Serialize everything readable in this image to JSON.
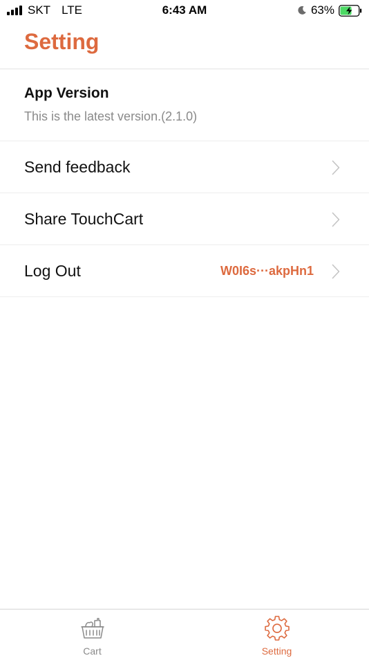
{
  "status_bar": {
    "carrier": "SKT",
    "network": "LTE",
    "time": "6:43 AM",
    "battery_percent": "63%",
    "battery_level": 0.63,
    "icons": [
      "signal-icon",
      "moon-icon",
      "battery-charging-icon"
    ]
  },
  "header": {
    "title": "Setting"
  },
  "settings": {
    "version": {
      "title": "App Version",
      "subtitle": "This is the latest version.(2.1.0)"
    },
    "items": [
      {
        "label": "Send feedback",
        "value": "",
        "icon": "chevron-right-icon"
      },
      {
        "label": "Share TouchCart",
        "value": "",
        "icon": "chevron-right-icon"
      },
      {
        "label": "Log Out",
        "value": "W0I6s···akpHn1",
        "icon": "chevron-right-icon"
      }
    ]
  },
  "tab_bar": {
    "tabs": [
      {
        "label": "Cart",
        "icon": "basket-icon",
        "active": false
      },
      {
        "label": "Setting",
        "icon": "gear-icon",
        "active": true
      }
    ]
  },
  "colors": {
    "accent": "#dd6a3f",
    "inactive": "#8a8a8a",
    "text": "#111111",
    "subtext": "#8a8a8a"
  }
}
